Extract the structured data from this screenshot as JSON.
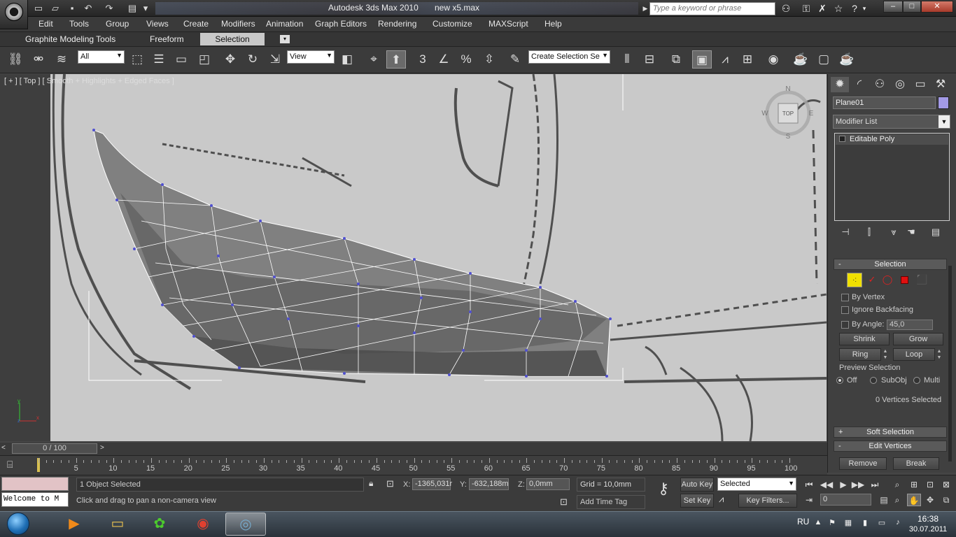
{
  "titlebar": {
    "app_title": "Autodesk 3ds Max  2010",
    "file_name": "new x5.max",
    "search_placeholder": "Type a keyword or phrase",
    "window_buttons": [
      "–",
      "□",
      "✕"
    ]
  },
  "menu": [
    "Edit",
    "Tools",
    "Group",
    "Views",
    "Create",
    "Modifiers",
    "Animation",
    "Graph Editors",
    "Rendering",
    "Customize",
    "MAXScript",
    "Help"
  ],
  "ribbon": {
    "tabs": [
      "Graphite Modeling Tools",
      "Freeform",
      "Selection"
    ],
    "selected": "Selection"
  },
  "toolbar": {
    "selection_filter": "All",
    "reference_coord": "View",
    "named_selection": "Create Selection Se",
    "snap_labels": [
      "3",
      "%"
    ]
  },
  "viewport": {
    "label": "[ + ] [ Top ] [ Smooth + Highlights + Edged Faces ]",
    "viewcube": {
      "top": "TOP",
      "n": "N",
      "s": "S",
      "e": "E",
      "w": "W"
    },
    "axis": {
      "y": "y",
      "x": "x",
      "z": "z"
    }
  },
  "command_panel": {
    "object_name": "Plane01",
    "object_color": "#a39ae6",
    "modifier_list": "Modifier List",
    "stack_item": "Editable Poly",
    "selection_rollout": {
      "title": "Selection",
      "by_vertex": "By Vertex",
      "ignore_backfacing": "Ignore Backfacing",
      "by_angle": "By Angle:",
      "angle_value": "45,0",
      "shrink": "Shrink",
      "grow": "Grow",
      "ring": "Ring",
      "loop": "Loop",
      "preview_title": "Preview Selection",
      "preview_options": [
        "Off",
        "SubObj",
        "Multi"
      ],
      "status": "0 Vertices Selected"
    },
    "soft_selection": "Soft Selection",
    "edit_vertices": "Edit Vertices",
    "remove": "Remove",
    "break": "Break"
  },
  "timeline": {
    "slider": "0 / 100",
    "ticks": [
      "5",
      "10",
      "15",
      "20",
      "25",
      "30",
      "35",
      "40",
      "45",
      "50",
      "55",
      "60",
      "65",
      "70",
      "75",
      "80",
      "85",
      "90",
      "95",
      "100"
    ]
  },
  "status": {
    "maxscript_text": "Welcome to M",
    "objects_selected": "1 Object Selected",
    "prompt": "Click and drag to pan a non-camera view",
    "x_label": "X:",
    "x_value": "-1365,031r",
    "y_label": "Y:",
    "y_value": "-632,188m",
    "z_label": "Z:",
    "z_value": "0,0mm",
    "grid": "Grid = 10,0mm",
    "add_time_tag": "Add Time Tag",
    "auto_key": "Auto Key",
    "set_key": "Set Key",
    "selected_dd": "Selected",
    "key_filters": "Key Filters...",
    "frame_value": "0"
  },
  "taskbar": {
    "lang": "RU",
    "time": "16:38",
    "date": "30.07.2011"
  }
}
